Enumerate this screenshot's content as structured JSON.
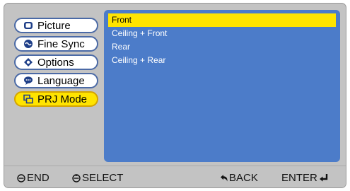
{
  "menu": {
    "items": [
      {
        "label": "Picture",
        "icon": "picture-icon"
      },
      {
        "label": "Fine Sync",
        "icon": "fine-sync-icon"
      },
      {
        "label": "Options",
        "icon": "options-icon"
      },
      {
        "label": "Language",
        "icon": "language-icon"
      },
      {
        "label": "PRJ Mode",
        "icon": "prj-mode-icon",
        "active": true
      }
    ]
  },
  "options": {
    "items": [
      "Front",
      "Ceiling + Front",
      "Rear",
      "Ceiling + Rear"
    ],
    "selected": "Front"
  },
  "bottom_bar": {
    "end_label": "END",
    "select_label": "SELECT",
    "back_label": "BACK",
    "enter_label": "ENTER"
  },
  "colors": {
    "panel": "#4c7cc9",
    "highlight": "#ffe400",
    "frame": "#c3c3c3",
    "pill_border": "#4b6aa6"
  }
}
